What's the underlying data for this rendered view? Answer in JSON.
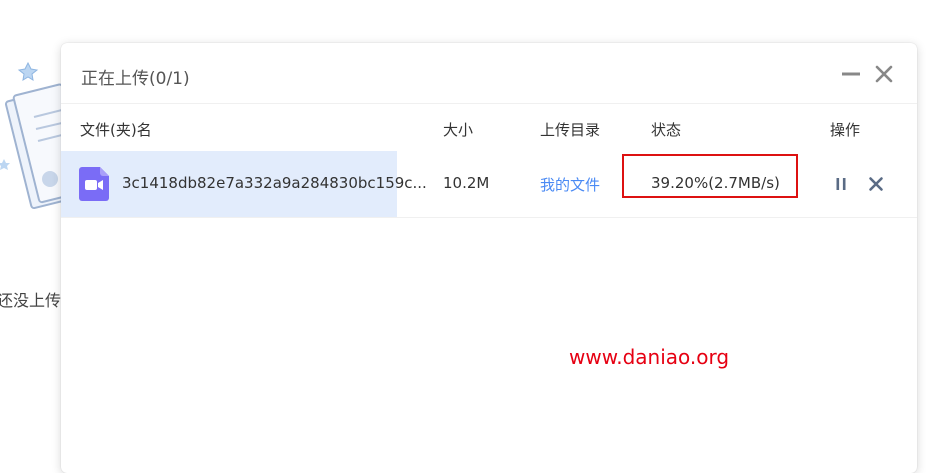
{
  "background": {
    "empty_text": "还没上传"
  },
  "panel": {
    "title": "正在上传(0/1)",
    "columns": {
      "name": "文件(夹)名",
      "size": "大小",
      "directory": "上传目录",
      "status": "状态",
      "action": "操作"
    },
    "rows": [
      {
        "file_name": "3c1418db82e7a332a9a284830bc159c...",
        "size": "10.2M",
        "directory": "我的文件",
        "status": "39.20%(2.7MB/s)",
        "icon": "video-file-icon"
      }
    ]
  },
  "watermark": "www.daniao.org",
  "colors": {
    "accent_blue": "#4a8af4",
    "row_highlight": "#e2ecfc",
    "annotation_red": "#dd1111",
    "watermark_red": "#e60012",
    "file_icon_purple": "#7a6cf6"
  }
}
